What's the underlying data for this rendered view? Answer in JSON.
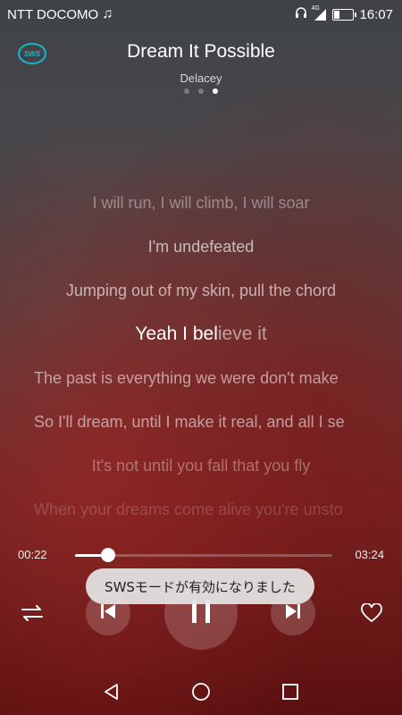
{
  "status_bar": {
    "carrier": "NTT DOCOMO",
    "network": "4G",
    "time": "16:07",
    "battery_level": 0.3
  },
  "header": {
    "sws_badge": "SWS",
    "title": "Dream It Possible",
    "artist": "Delacey",
    "pages": 3,
    "active_page": 3
  },
  "lyrics": {
    "lines": [
      "I will run, I will climb, I will soar",
      "I'm undefeated",
      "Jumping out of my skin, pull the chord",
      "Yeah I believe it",
      "The past is everything we were don't make",
      "So I'll dream, until I make it real, and all I se",
      "It's not until you fall that you fly",
      "When your dreams come alive you're unsto"
    ],
    "current_sung": "Yeah I bel",
    "current_rest": "ieve it"
  },
  "player": {
    "elapsed": "00:22",
    "total": "03:24",
    "progress": 0.13
  },
  "toast": {
    "message": "SWSモードが有効になりました"
  },
  "colors": {
    "accent": "#19b6c9",
    "toast_bg": "#e4e4e4"
  },
  "icons": {
    "shuffle": "shuffle-icon",
    "prev": "skip-previous-icon",
    "play": "pause-icon",
    "next": "skip-next-icon",
    "favorite": "heart-icon"
  }
}
